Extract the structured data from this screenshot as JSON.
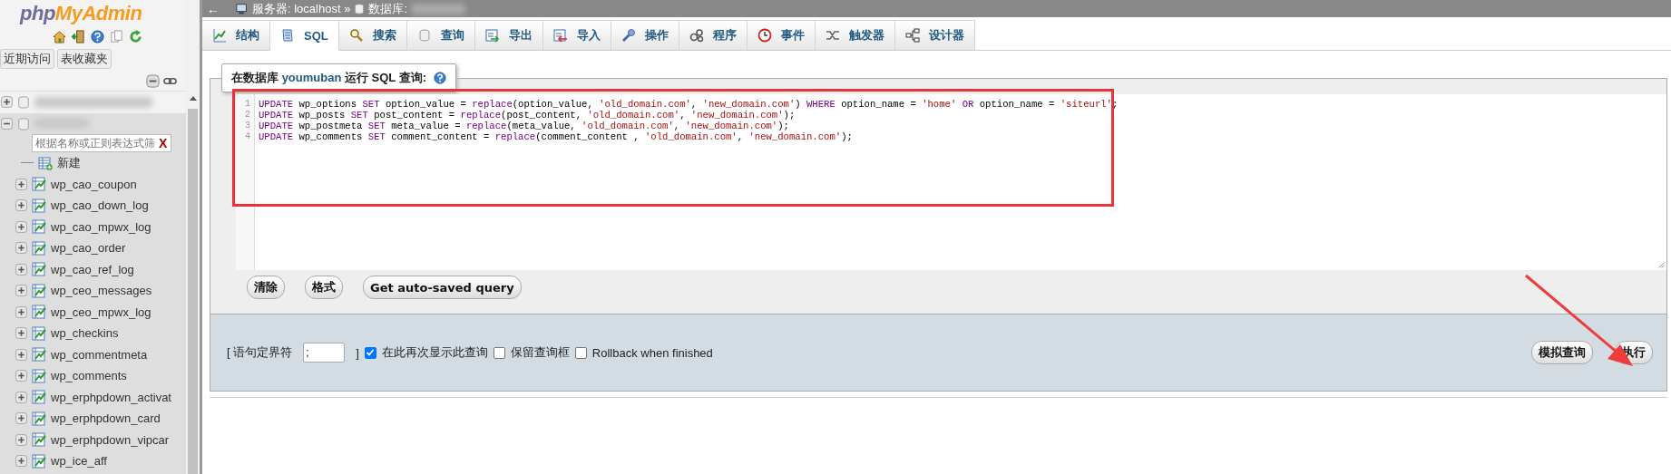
{
  "sidebar": {
    "logo": {
      "part1": "php",
      "part2": "MyAdmin"
    },
    "tabs": [
      {
        "label": "近期访问"
      },
      {
        "label": "表收藏夹"
      }
    ],
    "databases": [
      {
        "expanded": false
      },
      {
        "expanded": true,
        "filter_placeholder": "根据名称或正则表达式筛",
        "filter_clear": "X",
        "new_item": "新建",
        "tables": [
          {
            "name": "wp_cao_coupon"
          },
          {
            "name": "wp_cao_down_log"
          },
          {
            "name": "wp_cao_mpwx_log"
          },
          {
            "name": "wp_cao_order"
          },
          {
            "name": "wp_cao_ref_log"
          },
          {
            "name": "wp_ceo_messages"
          },
          {
            "name": "wp_ceo_mpwx_log"
          },
          {
            "name": "wp_checkins"
          },
          {
            "name": "wp_commentmeta"
          },
          {
            "name": "wp_comments"
          },
          {
            "name": "wp_erphpdown_activat"
          },
          {
            "name": "wp_erphpdown_card"
          },
          {
            "name": "wp_erphpdown_vipcar"
          },
          {
            "name": "wp_ice_aff"
          }
        ]
      }
    ]
  },
  "breadcrumb": {
    "back": "←",
    "server": "服务器: localhost »",
    "database": "数据库:"
  },
  "tabs": [
    {
      "label": "结构",
      "selected": false
    },
    {
      "label": "SQL",
      "selected": true
    },
    {
      "label": "搜索",
      "selected": false
    },
    {
      "label": "查询",
      "selected": false
    },
    {
      "label": "导出",
      "selected": false
    },
    {
      "label": "导入",
      "selected": false
    },
    {
      "label": "操作",
      "selected": false
    },
    {
      "label": "程序",
      "selected": false
    },
    {
      "label": "事件",
      "selected": false
    },
    {
      "label": "触发器",
      "selected": false
    },
    {
      "label": "设计器",
      "selected": false
    }
  ],
  "query_panel": {
    "legend_before": "在数据库",
    "legend_db": "youmuban",
    "legend_after": "运行 SQL 查询:",
    "lines": [
      {
        "number": "1",
        "tokens": [
          {
            "kind": "kw",
            "text": "UPDATE"
          },
          {
            "kind": "plain",
            "text": " wp_options "
          },
          {
            "kind": "kw",
            "text": "SET"
          },
          {
            "kind": "plain",
            "text": " option_value = "
          },
          {
            "kind": "kw",
            "text": "replace"
          },
          {
            "kind": "plain",
            "text": "(option_value, "
          },
          {
            "kind": "str",
            "text": "'old_domain.com'"
          },
          {
            "kind": "plain",
            "text": ", "
          },
          {
            "kind": "str",
            "text": "'new_domain.com'"
          },
          {
            "kind": "plain",
            "text": ") "
          },
          {
            "kind": "kw",
            "text": "WHERE"
          },
          {
            "kind": "plain",
            "text": " option_name = "
          },
          {
            "kind": "str",
            "text": "'home'"
          },
          {
            "kind": "kw",
            "text": " OR"
          },
          {
            "kind": "plain",
            "text": " option_name = "
          },
          {
            "kind": "str",
            "text": "'siteurl'"
          },
          {
            "kind": "plain",
            "text": ";"
          }
        ]
      },
      {
        "number": "2",
        "tokens": [
          {
            "kind": "kw",
            "text": "UPDATE"
          },
          {
            "kind": "plain",
            "text": " wp_posts "
          },
          {
            "kind": "kw",
            "text": "SET"
          },
          {
            "kind": "plain",
            "text": " post_content = "
          },
          {
            "kind": "kw",
            "text": "replace"
          },
          {
            "kind": "plain",
            "text": "(post_content, "
          },
          {
            "kind": "str",
            "text": "'old_domain.com'"
          },
          {
            "kind": "plain",
            "text": ", "
          },
          {
            "kind": "str",
            "text": "'new_domain.com'"
          },
          {
            "kind": "plain",
            "text": ");"
          }
        ]
      },
      {
        "number": "3",
        "tokens": [
          {
            "kind": "kw",
            "text": "UPDATE"
          },
          {
            "kind": "plain",
            "text": " wp_postmeta "
          },
          {
            "kind": "kw",
            "text": "SET"
          },
          {
            "kind": "plain",
            "text": " meta_value = "
          },
          {
            "kind": "kw",
            "text": "replace"
          },
          {
            "kind": "plain",
            "text": "(meta_value, "
          },
          {
            "kind": "str",
            "text": "'old_domain.com'"
          },
          {
            "kind": "plain",
            "text": ", "
          },
          {
            "kind": "str",
            "text": "'new_domain.com'"
          },
          {
            "kind": "plain",
            "text": ");"
          }
        ]
      },
      {
        "number": "4",
        "tokens": [
          {
            "kind": "kw",
            "text": "UPDATE"
          },
          {
            "kind": "plain",
            "text": " wp_comments "
          },
          {
            "kind": "kw",
            "text": "SET"
          },
          {
            "kind": "plain",
            "text": " comment_content = "
          },
          {
            "kind": "kw",
            "text": "replace"
          },
          {
            "kind": "plain",
            "text": "(comment_content , "
          },
          {
            "kind": "str",
            "text": "'old_domain.com'"
          },
          {
            "kind": "plain",
            "text": ", "
          },
          {
            "kind": "str",
            "text": "'new_domain.com'"
          },
          {
            "kind": "plain",
            "text": ");"
          }
        ]
      }
    ],
    "buttons": [
      "清除",
      "格式",
      "Get auto-saved query"
    ]
  },
  "footer": {
    "delimiter_open": "[ 语句定界符",
    "delimiter_value": ";",
    "delimiter_close": "]",
    "options": [
      {
        "label": "在此再次显示此查询",
        "checked": true
      },
      {
        "label": "保留查询框",
        "checked": false
      },
      {
        "label": "Rollback when finished",
        "checked": false
      }
    ],
    "buttons": [
      "模拟查询",
      "执行"
    ]
  }
}
